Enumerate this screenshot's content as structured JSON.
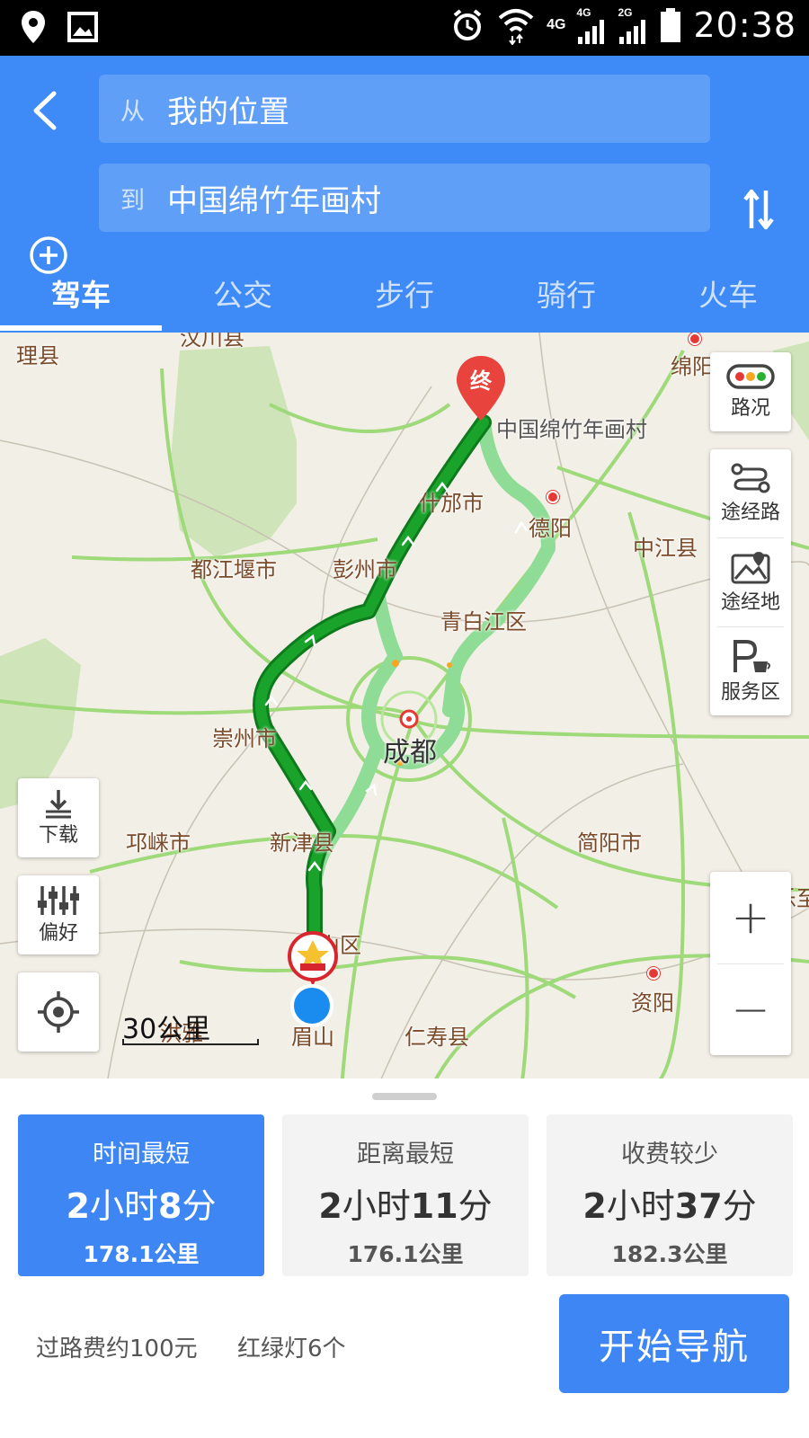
{
  "status_bar": {
    "time": "20:38",
    "network_1": "4G",
    "network_2": "4G",
    "network_3": "2G",
    "icons": [
      "location-pin-icon",
      "image-icon",
      "alarm-icon",
      "wifi-icon",
      "signal-icon",
      "battery-icon"
    ]
  },
  "header": {
    "from_prefix": "从",
    "from_value": "我的位置",
    "to_prefix": "到",
    "to_value": "中国绵竹年画村",
    "tabs": [
      {
        "label": "驾车",
        "active": true
      },
      {
        "label": "公交",
        "active": false
      },
      {
        "label": "步行",
        "active": false
      },
      {
        "label": "骑行",
        "active": false
      },
      {
        "label": "火车",
        "active": false
      }
    ]
  },
  "map": {
    "labels": {
      "lixian": "理县",
      "wenchuan": "汶川县",
      "mianyang": "绵阳",
      "destination": "中国绵竹年画村",
      "shifang": "什邡市",
      "deyang": "德阳",
      "zhongjiang": "中江县",
      "dujiangyan": "都江堰市",
      "pengzhou": "彭州市",
      "qingbaijiang": "青白江区",
      "chengdu": "成都",
      "chongzhou": "崇州市",
      "qionglai": "邛崃市",
      "xinjin": "新津县",
      "jianyang": "简阳市",
      "pengshan": "彭山区",
      "ziyang": "资阳",
      "meishan": "眉山",
      "renshou": "仁寿县",
      "hongya": "洪雅",
      "lezhi": "乐至"
    },
    "end_marker": "终",
    "controls": {
      "traffic": "路况",
      "via_route": "途经路",
      "via_place": "途经地",
      "service_area": "服务区",
      "download": "下载",
      "preference": "偏好",
      "zoom_in": "+",
      "zoom_out": "−"
    },
    "scale": "30公里",
    "colors": {
      "route_main": "#1aa32a",
      "route_alt": "#8fdc96",
      "accent": "#3e8af7"
    }
  },
  "routes": [
    {
      "label": "时间最短",
      "time_h": "2",
      "time_h_unit": "小时",
      "time_m": "8",
      "time_m_unit": "分",
      "distance": "178.1公里",
      "active": true
    },
    {
      "label": "距离最短",
      "time_h": "2",
      "time_h_unit": "小时",
      "time_m": "11",
      "time_m_unit": "分",
      "distance": "176.1公里",
      "active": false
    },
    {
      "label": "收费较少",
      "time_h": "2",
      "time_h_unit": "小时",
      "time_m": "37",
      "time_m_unit": "分",
      "distance": "182.3公里",
      "active": false
    }
  ],
  "footer": {
    "toll": "过路费约100元",
    "lights": "红绿灯6个",
    "start_button": "开始导航"
  }
}
